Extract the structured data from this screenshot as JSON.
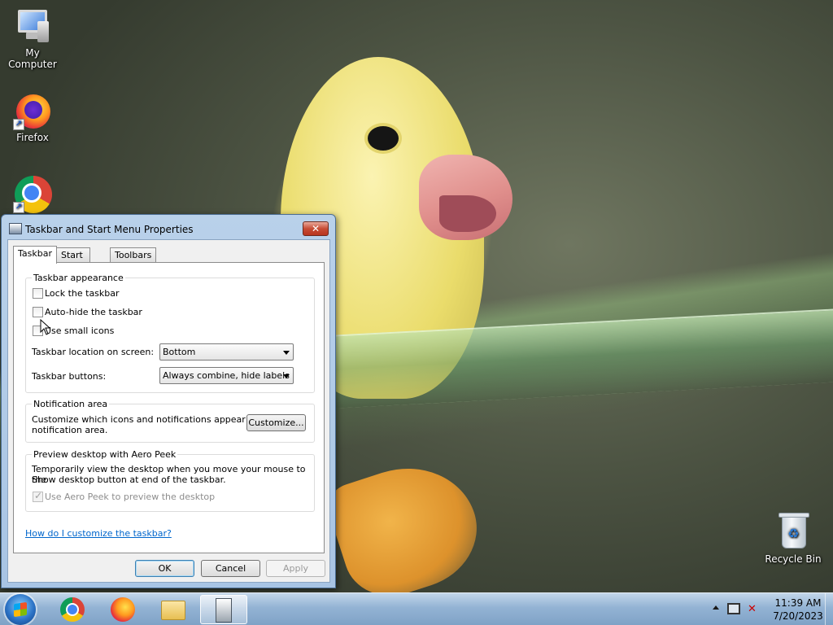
{
  "desktop": {
    "icons": [
      {
        "label": "My Computer"
      },
      {
        "label": "Firefox"
      },
      {
        "label": ""
      },
      {
        "label": "Recycle Bin"
      }
    ]
  },
  "dialog": {
    "title": "Taskbar and Start Menu Properties",
    "close_glyph": "✕",
    "tabs": [
      {
        "label": "Taskbar",
        "active": true
      },
      {
        "label": "Start Menu",
        "active": false
      },
      {
        "label": "Toolbars",
        "active": false
      }
    ],
    "appearance": {
      "legend": "Taskbar appearance",
      "lock_label": "Lock the taskbar",
      "lock_checked": false,
      "autohide_label": "Auto-hide the taskbar",
      "autohide_checked": false,
      "small_icons_label": "Use small icons",
      "small_icons_checked": false,
      "location_label": "Taskbar location on screen:",
      "location_value": "Bottom",
      "buttons_label": "Taskbar buttons:",
      "buttons_value": "Always combine, hide labels"
    },
    "notification": {
      "legend": "Notification area",
      "description_line1": "Customize which icons and notifications appear in the",
      "description_line2": "notification area.",
      "customize_label": "Customize..."
    },
    "aero_peek": {
      "legend": "Preview desktop with Aero Peek",
      "description_line1": "Temporarily view the desktop when you move your mouse to the",
      "description_line2": "Show desktop button at end of the taskbar.",
      "use_label": "Use Aero Peek to preview the desktop",
      "use_checked": true
    },
    "help_link": "How do I customize the taskbar?",
    "buttons": {
      "ok": "OK",
      "cancel": "Cancel",
      "apply": "Apply"
    }
  },
  "taskbar": {
    "clock_time": "11:39 AM",
    "clock_date": "7/20/2023"
  }
}
